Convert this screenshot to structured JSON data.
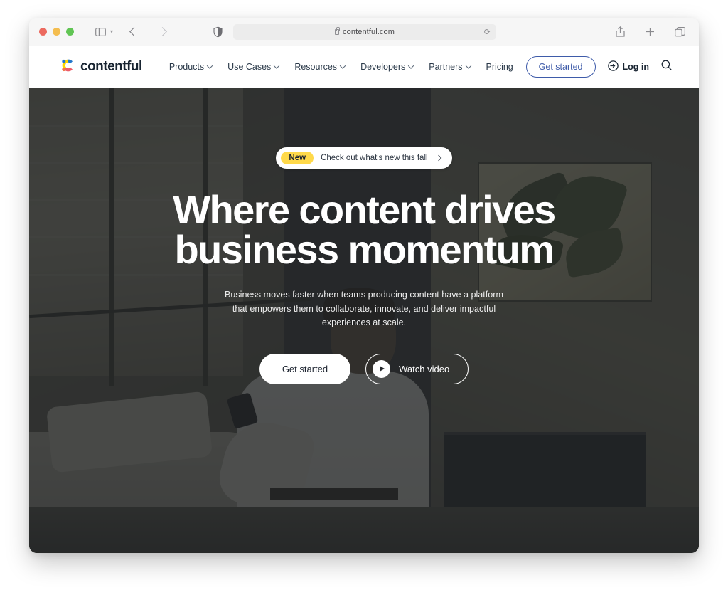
{
  "browser": {
    "traffic_lights": [
      "close",
      "minimize",
      "zoom"
    ],
    "sidebar_icon": "sidebar-icon",
    "sidebar_caret_icon": "chevron-down-icon",
    "back_icon": "chevron-left-icon",
    "forward_icon": "chevron-right-icon",
    "shield_icon": "shield-icon",
    "url": "contentful.com",
    "lock_icon": "lock-icon",
    "reload_icon": "reload-icon",
    "share_icon": "share-icon",
    "new_tab_icon": "plus-icon",
    "tab_overview_icon": "tab-overview-icon"
  },
  "site_header": {
    "logo_text": "contentful",
    "logo_icon": "contentful-logo-icon",
    "nav": [
      {
        "label": "Products",
        "has_chevron": true
      },
      {
        "label": "Use Cases",
        "has_chevron": true
      },
      {
        "label": "Resources",
        "has_chevron": true
      },
      {
        "label": "Developers",
        "has_chevron": true
      },
      {
        "label": "Partners",
        "has_chevron": true
      },
      {
        "label": "Pricing",
        "has_chevron": false
      }
    ],
    "get_started_label": "Get started",
    "login_label": "Log in",
    "login_icon": "login-arrow-icon",
    "search_icon": "search-icon"
  },
  "hero": {
    "announcement": {
      "badge": "New",
      "text": "Check out what's new this fall",
      "chevron_icon": "chevron-right-icon"
    },
    "title": "Where content drives business momentum",
    "subtitle": "Business moves faster when teams producing content have a platform that empowers them to collaborate, innovate, and deliver impactful experiences at scale.",
    "primary_cta": "Get started",
    "secondary_cta": "Watch video",
    "play_icon": "play-icon"
  },
  "colors": {
    "brand_blue": "#3e5ba9",
    "badge_yellow": "#ffd94a",
    "text_dark": "#192532",
    "hero_overlay": "rgba(32,34,36,0.76)"
  }
}
